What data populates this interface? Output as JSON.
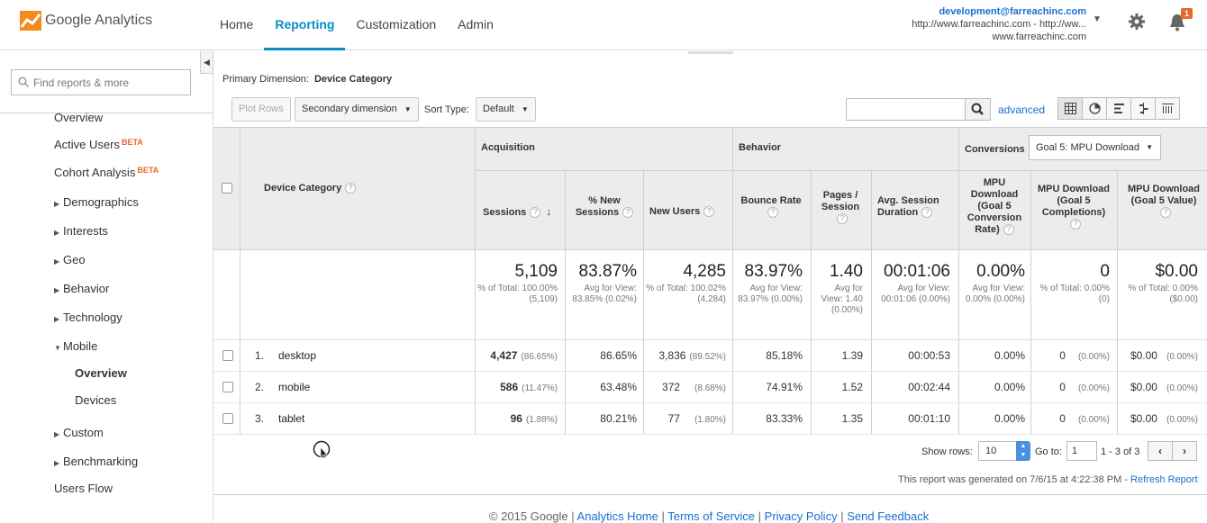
{
  "app": {
    "logo_text": "Google Analytics"
  },
  "topnav": [
    {
      "label": "Home",
      "active": false
    },
    {
      "label": "Reporting",
      "active": true
    },
    {
      "label": "Customization",
      "active": false
    },
    {
      "label": "Admin",
      "active": false
    }
  ],
  "account": {
    "email": "development@farreachinc.com",
    "property": "http://www.farreachinc.com - http://ww...",
    "view": "www.farreachinc.com"
  },
  "notifications": {
    "count": "1"
  },
  "sidebar": {
    "search_placeholder": "Find reports & more",
    "items": {
      "overview": "Overview",
      "active_users": "Active Users",
      "cohort": "Cohort Analysis",
      "beta": "BETA",
      "demographics": "Demographics",
      "interests": "Interests",
      "geo": "Geo",
      "behavior": "Behavior",
      "technology": "Technology",
      "mobile": "Mobile",
      "mobile_overview": "Overview",
      "devices": "Devices",
      "custom": "Custom",
      "benchmarking": "Benchmarking",
      "users_flow": "Users Flow"
    }
  },
  "report": {
    "primary_dimension_label": "Primary Dimension:",
    "primary_dimension_value": "Device Category",
    "plot_rows": "Plot Rows",
    "secondary_dimension": "Secondary dimension",
    "sort_type_label": "Sort Type:",
    "sort_type_value": "Default",
    "advanced": "advanced"
  },
  "table": {
    "groups": {
      "acquisition": "Acquisition",
      "behavior": "Behavior",
      "conversions": "Conversions"
    },
    "goal_select": "Goal 5: MPU Download",
    "headers": {
      "dimension": "Device Category",
      "sessions": "Sessions",
      "new_sessions": "% New Sessions",
      "new_users": "New Users",
      "bounce_rate": "Bounce Rate",
      "pages_session": "Pages / Session",
      "avg_duration": "Avg. Session Duration",
      "conv_rate": "MPU Download (Goal 5 Conversion Rate)",
      "completions": "MPU Download (Goal 5 Completions)",
      "value": "MPU Download (Goal 5 Value)"
    },
    "totals": {
      "sessions": {
        "big": "5,109",
        "small": "% of Total: 100.00% (5,109)"
      },
      "new_sessions": {
        "big": "83.87%",
        "small": "Avg for View: 83.85% (0.02%)"
      },
      "new_users": {
        "big": "4,285",
        "small": "% of Total: 100.02% (4,284)"
      },
      "bounce_rate": {
        "big": "83.97%",
        "small": "Avg for View: 83.97% (0.00%)"
      },
      "pages_session": {
        "big": "1.40",
        "small": "Avg for View: 1.40 (0.00%)"
      },
      "avg_duration": {
        "big": "00:01:06",
        "small": "Avg for View: 00:01:06 (0.00%)"
      },
      "conv_rate": {
        "big": "0.00%",
        "small": "Avg for View: 0.00% (0.00%)"
      },
      "completions": {
        "big": "0",
        "small": "% of Total: 0.00% (0)"
      },
      "value": {
        "big": "$0.00",
        "small": "% of Total: 0.00% ($0.00)"
      }
    },
    "rows": [
      {
        "idx": "1.",
        "name": "desktop",
        "sessions": "4,427",
        "sessions_pct": "(86.65%)",
        "new_sessions": "86.65%",
        "new_users": "3,836",
        "new_users_pct": "(89.52%)",
        "bounce": "85.18%",
        "pages": "1.39",
        "duration": "00:00:53",
        "conv": "0.00%",
        "comp": "0",
        "comp_pct": "(0.00%)",
        "value": "$0.00",
        "value_pct": "(0.00%)"
      },
      {
        "idx": "2.",
        "name": "mobile",
        "sessions": "586",
        "sessions_pct": "(11.47%)",
        "new_sessions": "63.48%",
        "new_users": "372",
        "new_users_pct": "(8.68%)",
        "bounce": "74.91%",
        "pages": "1.52",
        "duration": "00:02:44",
        "conv": "0.00%",
        "comp": "0",
        "comp_pct": "(0.00%)",
        "value": "$0.00",
        "value_pct": "(0.00%)"
      },
      {
        "idx": "3.",
        "name": "tablet",
        "sessions": "96",
        "sessions_pct": "(1.88%)",
        "new_sessions": "80.21%",
        "new_users": "77",
        "new_users_pct": "(1.80%)",
        "bounce": "83.33%",
        "pages": "1.35",
        "duration": "00:01:10",
        "conv": "0.00%",
        "comp": "0",
        "comp_pct": "(0.00%)",
        "value": "$0.00",
        "value_pct": "(0.00%)"
      }
    ]
  },
  "pagination": {
    "show_rows_label": "Show rows:",
    "show_rows_value": "10",
    "goto_label": "Go to:",
    "goto_value": "1",
    "range": "1 - 3 of 3"
  },
  "generated": {
    "text": "This report was generated on 7/6/15 at 4:22:38 PM -",
    "refresh": "Refresh Report"
  },
  "footer": {
    "copyright": "© 2015 Google |",
    "links": [
      "Analytics Home",
      "Terms of Service",
      "Privacy Policy",
      "Send Feedback"
    ]
  }
}
